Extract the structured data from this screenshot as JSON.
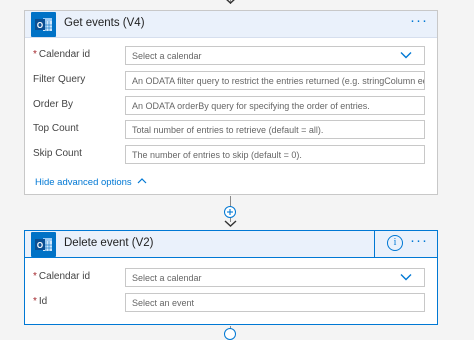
{
  "colors": {
    "accent": "#0078d4",
    "header_bg": "#eaf1fb",
    "outlook_blue": "#0072c6"
  },
  "get_events": {
    "title": "Get events (V4)",
    "icon": "outlook-calendar-icon",
    "more_label": "···",
    "fields": [
      {
        "label": "Calendar id",
        "required": true,
        "placeholder": "Select a calendar",
        "dropdown": true
      },
      {
        "label": "Filter Query",
        "required": false,
        "placeholder": "An ODATA filter query to restrict the entries returned (e.g. stringColumn eq 'stri"
      },
      {
        "label": "Order By",
        "required": false,
        "placeholder": "An ODATA orderBy query for specifying the order of entries."
      },
      {
        "label": "Top Count",
        "required": false,
        "placeholder": "Total number of entries to retrieve (default = all)."
      },
      {
        "label": "Skip Count",
        "required": false,
        "placeholder": "The number of entries to skip (default = 0)."
      }
    ],
    "advanced_link": "Hide advanced options"
  },
  "delete_event": {
    "title": "Delete event (V2)",
    "icon": "outlook-calendar-icon",
    "info_label": "i",
    "more_label": "···",
    "fields": [
      {
        "label": "Calendar id",
        "required": true,
        "placeholder": "Select a calendar",
        "dropdown": true
      },
      {
        "label": "Id",
        "required": true,
        "placeholder": "Select an event"
      }
    ]
  }
}
